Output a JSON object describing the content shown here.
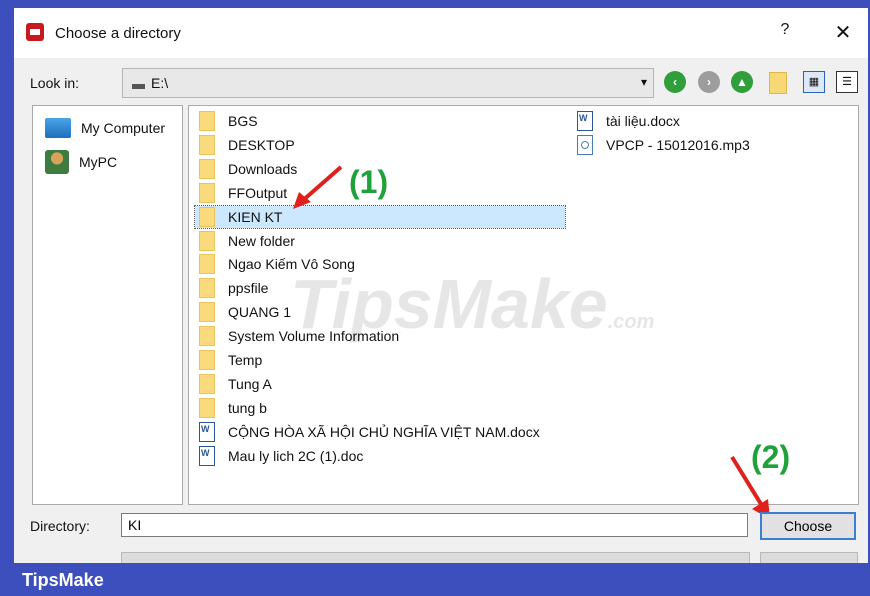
{
  "window": {
    "title": "Choose a directory",
    "help_label": "?",
    "close_label": "✕",
    "app_icon": "app-logo-icon"
  },
  "toolbar": {
    "look_in_label": "Look in:",
    "look_in_value": "E:\\",
    "dropdown_arrow": "▾",
    "back_label": "‹",
    "forward_label": "›",
    "up_label": "▲",
    "detail_view_label": "▦",
    "list_view_label": "☰"
  },
  "sidebar": {
    "items": [
      {
        "label": "My Computer",
        "icon": "computer-icon"
      },
      {
        "label": "MyPC",
        "icon": "user-icon"
      }
    ]
  },
  "files": {
    "col1": [
      {
        "name": "BGS",
        "type": "folder"
      },
      {
        "name": "DESKTOP",
        "type": "folder"
      },
      {
        "name": "Downloads",
        "type": "folder"
      },
      {
        "name": "FFOutput",
        "type": "folder"
      },
      {
        "name": "KIEN KT",
        "type": "folder",
        "selected": true
      },
      {
        "name": "New folder",
        "type": "folder"
      },
      {
        "name": "Ngao Kiếm Vô Song",
        "type": "folder"
      },
      {
        "name": "ppsfile",
        "type": "folder"
      },
      {
        "name": "QUANG 1",
        "type": "folder"
      },
      {
        "name": "System Volume Information",
        "type": "folder"
      },
      {
        "name": "Temp",
        "type": "folder"
      },
      {
        "name": "Tung A",
        "type": "folder"
      },
      {
        "name": "tung b",
        "type": "folder"
      },
      {
        "name": "CỘNG HÒA XÃ HỘI CHỦ NGHĨA VIỆT NAM.docx",
        "type": "doc"
      },
      {
        "name": "Mau ly lich 2C (1).doc",
        "type": "doc"
      }
    ],
    "col2": [
      {
        "name": "tài liệu.docx",
        "type": "doc"
      },
      {
        "name": "VPCP - 15012016.mp3",
        "type": "mp3"
      }
    ]
  },
  "annotations": {
    "step1": "(1)",
    "step2": "(2)"
  },
  "watermark": {
    "main": "TipsMake",
    "suffix": ".com"
  },
  "footer": {
    "directory_label": "Directory:",
    "directory_value": "KI",
    "choose_label": "Choose"
  },
  "brand": "TipsMake",
  "colors": {
    "accent": "#3c4fbc",
    "selection": "#cce8ff",
    "annotation": "#1fa23a",
    "arrow": "#e0201b"
  }
}
